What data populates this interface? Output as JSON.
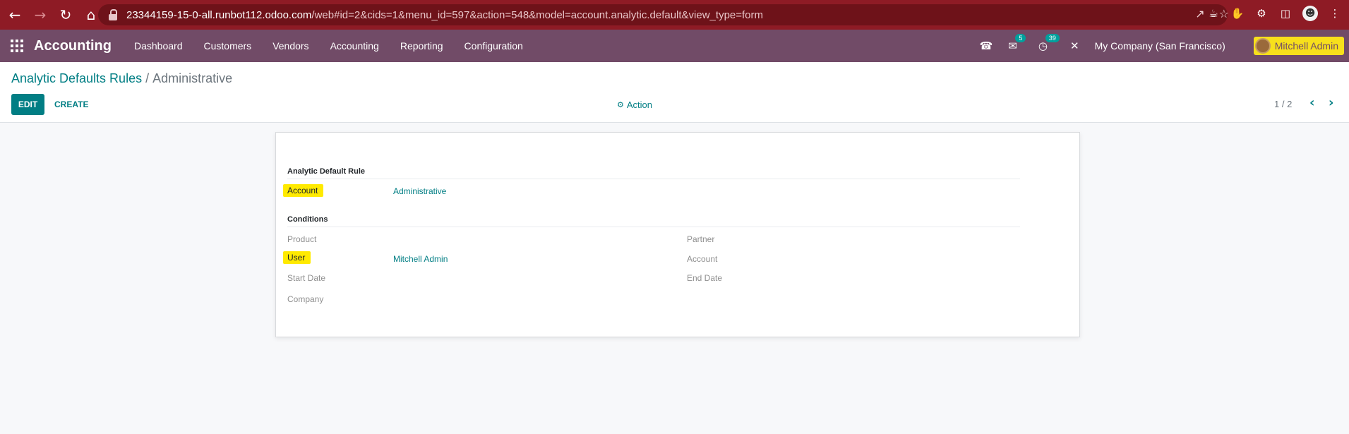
{
  "browser": {
    "url_host": "23344159-15-0-all.runbot112.odoo.com",
    "url_path": "/web#id=2&cids=1&menu_id=597&action=548&model=account.analytic.default&view_type=form"
  },
  "navbar": {
    "app_name": "Accounting",
    "menu": [
      "Dashboard",
      "Customers",
      "Vendors",
      "Accounting",
      "Reporting",
      "Configuration"
    ],
    "messages_badge": "5",
    "activities_badge": "39",
    "company": "My Company (San Francisco)",
    "user": "Mitchell Admin"
  },
  "control_panel": {
    "breadcrumb_parent": "Analytic Defaults Rules",
    "breadcrumb_separator": "/",
    "breadcrumb_current": "Administrative",
    "edit_label": "EDIT",
    "create_label": "CREATE",
    "action_label": "Action",
    "pager": "1 / 2"
  },
  "form": {
    "rule_group_title": "Analytic Default Rule",
    "account_label": "Account",
    "account_value": "Administrative",
    "conditions_title": "Conditions",
    "product_label": "Product",
    "user_label": "User",
    "user_value": "Mitchell Admin",
    "start_date_label": "Start Date",
    "company_label": "Company",
    "partner_label": "Partner",
    "cond_account_label": "Account",
    "end_date_label": "End Date"
  },
  "colors": {
    "browser_bar": "#8e1b25",
    "navbar": "#714b67",
    "primary": "#017e84",
    "highlight": "#ffea00"
  }
}
